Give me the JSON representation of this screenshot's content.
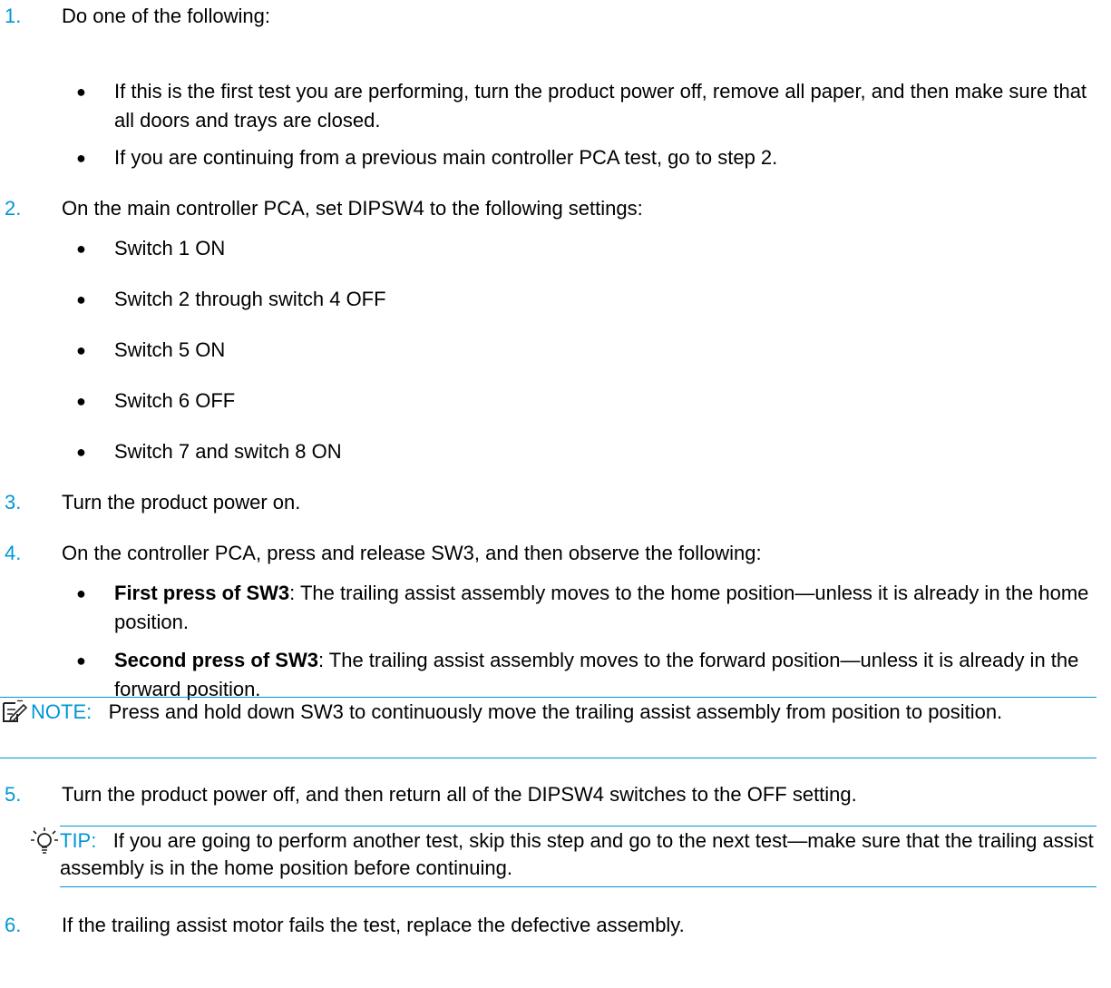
{
  "steps": [
    {
      "num": "1.",
      "text": "Do one of the following:"
    },
    {
      "num": "2.",
      "text": "On the main controller PCA, set DIPSW4 to the following settings:"
    },
    {
      "num": "3.",
      "text": "Turn the product power on."
    },
    {
      "num": "4.",
      "text": "On the controller PCA, press and release SW3, and then observe the following:"
    },
    {
      "num": "5.",
      "text": "Turn the product power off, and then return all of the DIPSW4 switches to the OFF setting."
    },
    {
      "num": "6.",
      "text": "If the trailing assist motor fails the test, replace the defective assembly."
    }
  ],
  "step1_bullets": [
    "If this is the first test you are performing, turn the product power off, remove all paper, and then make sure that all doors and trays are closed.",
    "If you are continuing from a previous main controller PCA test, go to step 2."
  ],
  "step2_bullets": [
    "Switch 1 ON",
    "Switch 2 through switch 4 OFF",
    "Switch 5 ON",
    "Switch 6 OFF",
    "Switch 7 and switch 8 ON"
  ],
  "step4_bullets": [
    {
      "bold": "First press of SW3",
      "text": ": The trailing assist assembly moves to the home position—unless it is already in the home position."
    },
    {
      "bold": "Second press of SW3",
      "text": ": The trailing assist assembly moves to the forward position—unless it is already in the forward position."
    }
  ],
  "note": {
    "label": "NOTE:",
    "text": "Press and hold down SW3 to continuously move the trailing assist assembly from position to position.",
    "icon": "note-icon"
  },
  "tip": {
    "label": "TIP:",
    "text": "If you are going to perform another test, skip this step and go to the next test—make sure that the trailing assist assembly is in the home position before continuing.",
    "icon": "lightbulb-icon"
  },
  "bullet_char": "●",
  "colors": {
    "accent": "#0096d6",
    "text": "#000000"
  }
}
